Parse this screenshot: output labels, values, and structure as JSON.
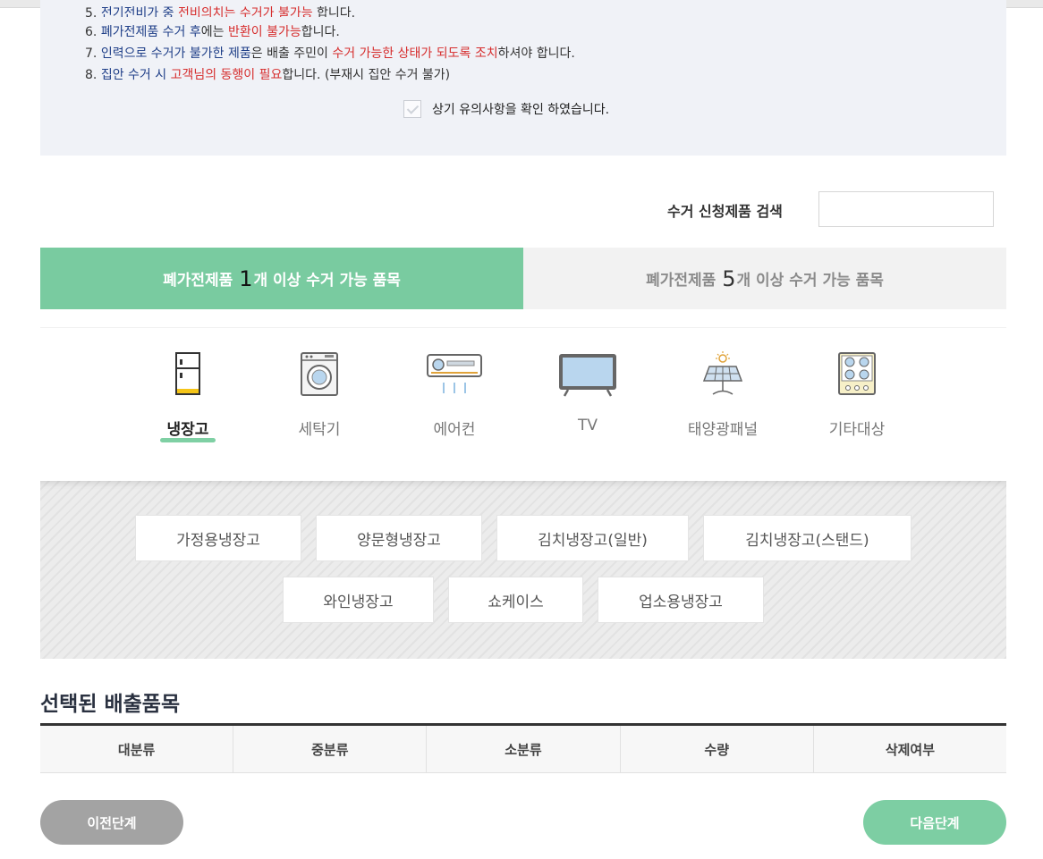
{
  "notice": {
    "line1": {
      "num": "5.",
      "p1": "전기전비가 중 ",
      "p2": "전비의치는 수거가 불가능",
      "p3": " 합니다."
    },
    "line2": {
      "num": "6.",
      "p1": "폐가전제품 수거 후",
      "p2": "에는 ",
      "p3": "반환이 불가능",
      "p4": "합니다."
    },
    "line3": {
      "num": "7.",
      "p1": "인력으로 수거가 불가한 제품",
      "p2": "은 배출 주민이 ",
      "p3": "수거 가능한 상태가 되도록 조치",
      "p4": "하셔야 합니다."
    },
    "line4": {
      "num": "8.",
      "p1": "집안 수거 시 ",
      "p2": "고객님의 동행이 필요",
      "p3": "합니다. (부재시 집안 수거 불가)"
    },
    "agree_label": "상기 유의사항을 확인 하였습니다."
  },
  "search": {
    "label": "수거 신청제품 검색",
    "value": "",
    "placeholder": ""
  },
  "tabs": [
    {
      "prefix": "폐가전제품 ",
      "num": "1",
      "suffix": "개 이상 수거 가능 품목",
      "active": true
    },
    {
      "prefix": "폐가전제품 ",
      "num": "5",
      "suffix": "개 이상 수거 가능 품목",
      "active": false
    }
  ],
  "categories": [
    {
      "label": "냉장고",
      "icon": "refrigerator-icon",
      "active": true
    },
    {
      "label": "세탁기",
      "icon": "washing-machine-icon",
      "active": false
    },
    {
      "label": "에어컨",
      "icon": "air-conditioner-icon",
      "active": false
    },
    {
      "label": "TV",
      "icon": "tv-icon",
      "active": false
    },
    {
      "label": "태양광패널",
      "icon": "solar-panel-icon",
      "active": false
    },
    {
      "label": "기타대상",
      "icon": "stove-icon",
      "active": false
    }
  ],
  "sub_options": [
    "가정용냉장고",
    "양문형냉장고",
    "김치냉장고(일반)",
    "김치냉장고(스탠드)",
    "와인냉장고",
    "쇼케이스",
    "업소용냉장고"
  ],
  "selected": {
    "title": "선택된 배출품목",
    "columns": [
      "대분류",
      "중분류",
      "소분류",
      "수량",
      "삭제여부"
    ]
  },
  "buttons": {
    "prev": "이전단계",
    "next": "다음단계"
  },
  "colors": {
    "accent_green": "#79cba0",
    "link_blue": "#1f3f88",
    "warn_red": "#d62d2d"
  }
}
